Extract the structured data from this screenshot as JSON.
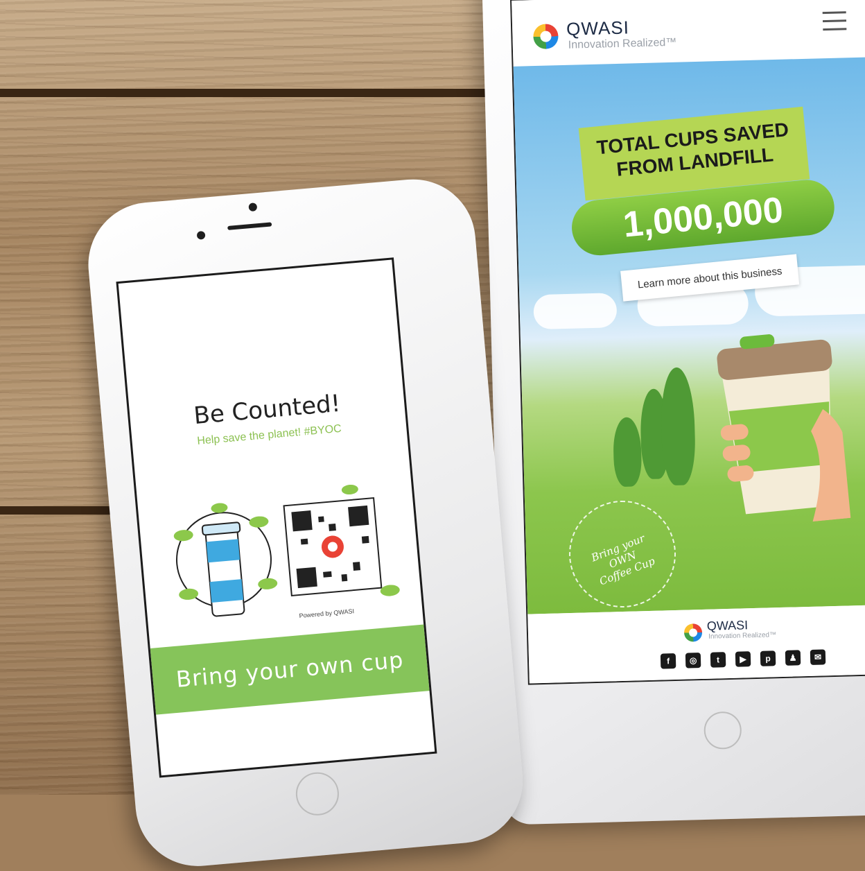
{
  "phone": {
    "title": "Be Counted!",
    "subtitle": "Help save the planet! #BYOC",
    "powered_by": "Powered by QWASI",
    "cta": "Bring your own cup"
  },
  "tablet": {
    "brand": "QWASI",
    "tagline": "Innovation Realized™",
    "banner_line1": "TOTAL CUPS SAVED",
    "banner_line2": "FROM LANDFILL",
    "count": "1,000,000",
    "learn_more": "Learn more about this business",
    "badge_line1": "Bring your",
    "badge_line2": "OWN",
    "badge_line3": "Coffee Cup",
    "footer_brand": "QWASI",
    "footer_tagline": "Innovation Realized™",
    "social_icons": [
      "facebook-icon",
      "instagram-icon",
      "twitter-icon",
      "youtube-icon",
      "pinterest-icon",
      "snapchat-icon",
      "email-icon"
    ]
  },
  "colors": {
    "accent_green": "#86c45a",
    "wood": "#a5845f"
  }
}
